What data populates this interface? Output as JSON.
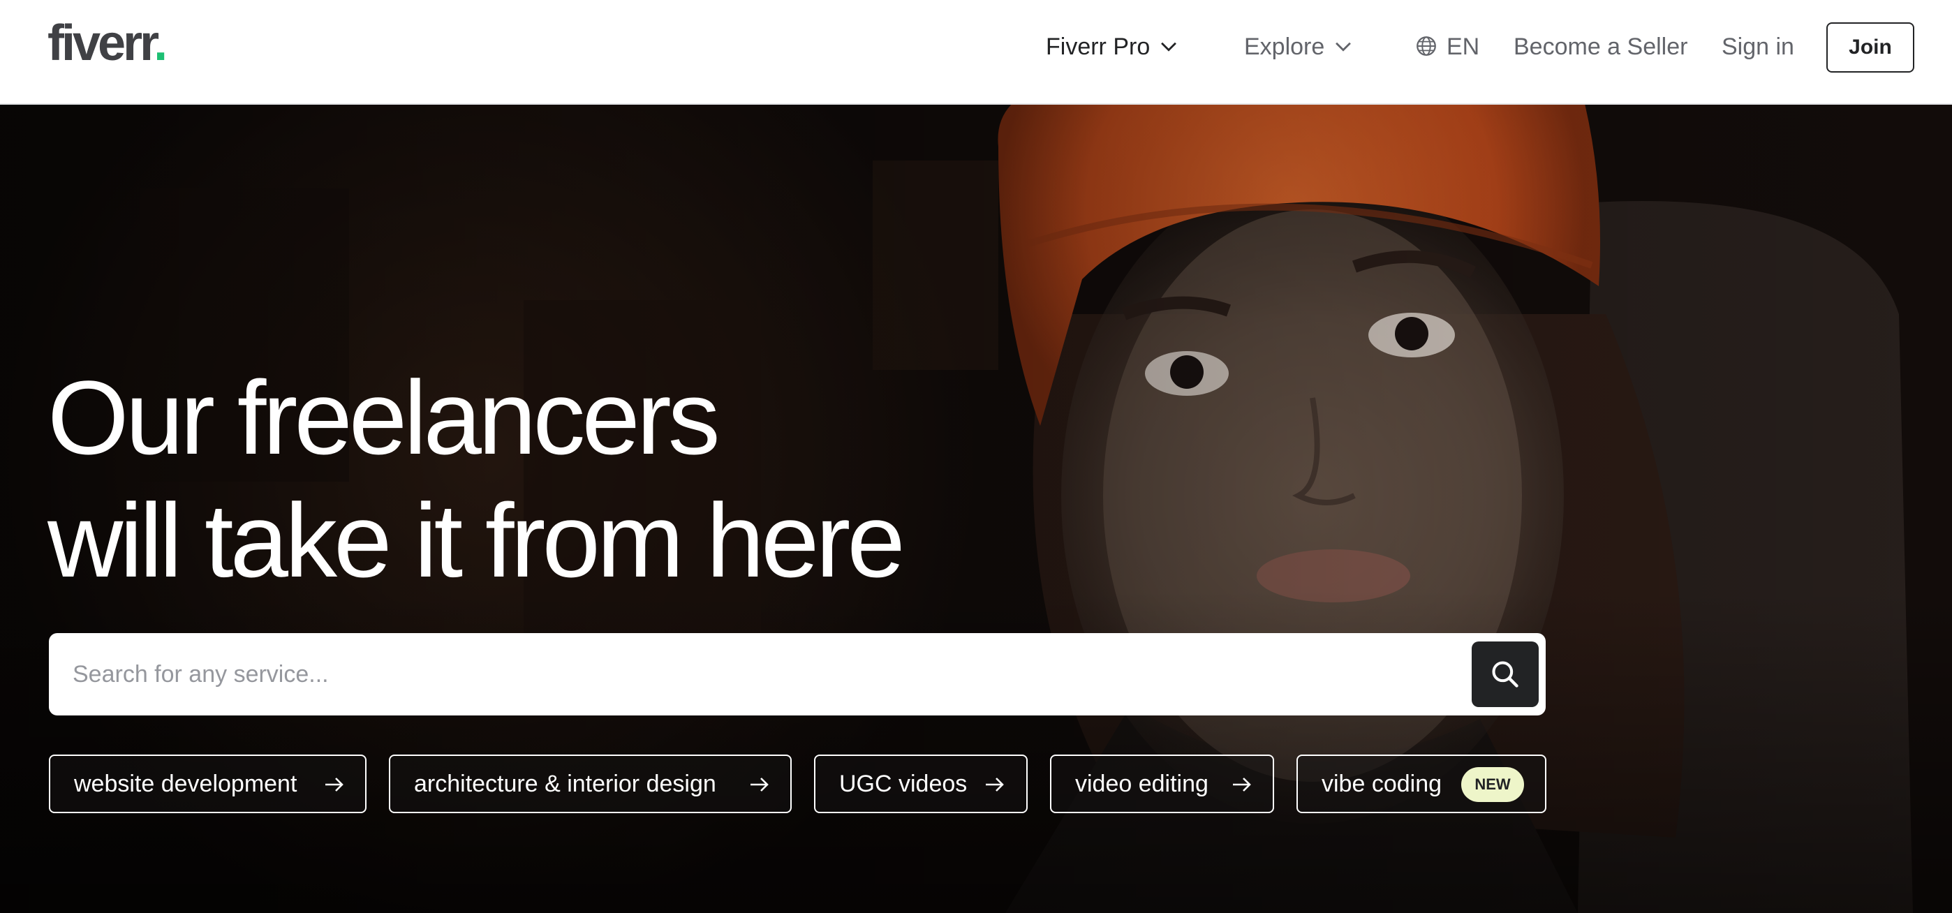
{
  "header": {
    "logo_text": "fiverr",
    "logo_dot": ".",
    "nav": {
      "fiverr_pro": "Fiverr Pro",
      "explore": "Explore",
      "language": "EN",
      "become_seller": "Become a Seller",
      "sign_in": "Sign in",
      "join": "Join"
    }
  },
  "hero": {
    "headline_line1": "Our freelancers",
    "headline_line2": "will take it from here",
    "search": {
      "placeholder": "Search for any service...",
      "value": ""
    },
    "chips": [
      {
        "label": "website development"
      },
      {
        "label": "architecture & interior design"
      },
      {
        "label": "UGC videos"
      },
      {
        "label": "video editing"
      },
      {
        "label": "vibe coding",
        "badge": "NEW"
      }
    ]
  },
  "icons": {
    "globe": "globe-icon",
    "chevron": "chevron-down-icon",
    "search": "search-icon",
    "arrow": "arrow-right-icon"
  },
  "colors": {
    "brand_green": "#1dbf73",
    "text_dark": "#222325",
    "text_grey": "#62646a",
    "logo_grey": "#404145",
    "badge_bg": "#eef5c9",
    "hat_orange": "#d4551f"
  }
}
